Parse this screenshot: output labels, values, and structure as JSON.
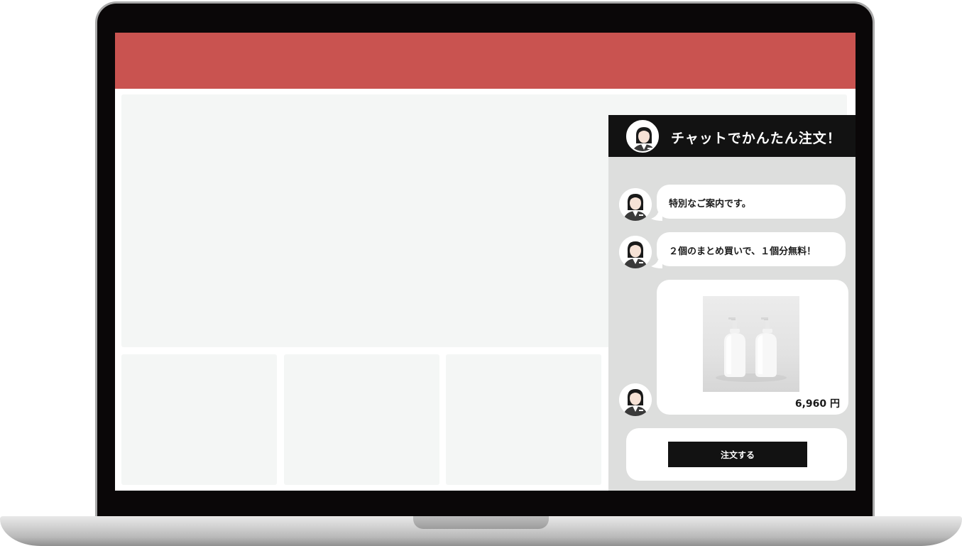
{
  "chat": {
    "title": "チャットでかんたん注文！",
    "messages": [
      {
        "text": "特別なご案内です。"
      },
      {
        "text": "２個のまとめ買いで、１個分無料！"
      }
    ],
    "product": {
      "image_icon": "pump-bottles-image",
      "price": "6,960 円"
    },
    "order_button_label": "注文する"
  },
  "colors": {
    "header_accent": "#c95350",
    "chat_header": "#121212",
    "chat_background": "#dddedd",
    "placeholder": "#f4f6f5"
  }
}
